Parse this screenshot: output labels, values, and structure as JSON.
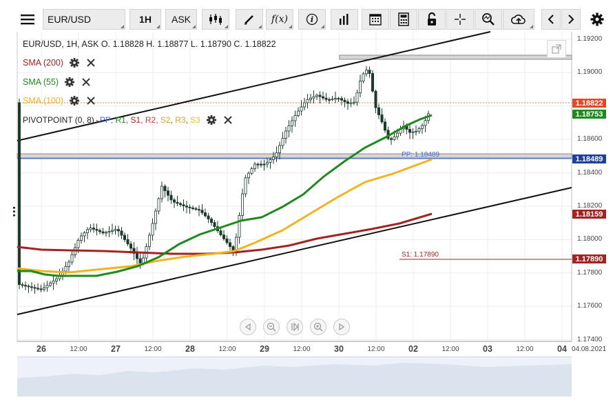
{
  "toolbar": {
    "symbol": "EUR/USD",
    "timeframe": "1H",
    "price_type": "ASK",
    "function_label": "f(x)"
  },
  "header": {
    "info": "EUR/USD, 1H, ASK   O. 1.18828 H. 1.18877 L. 1.18790 C. 1.18822"
  },
  "indicators": {
    "sma200": "SMA (200)",
    "sma55": "SMA (55)",
    "sma100": "SMA (100)",
    "pivot_prefix": "PIVOTPOINT (0, 8)",
    "pivot_pp": "PP",
    "pivot_r1": "R1",
    "pivot_s1": "S1",
    "pivot_r2": "R2",
    "pivot_s2": "S2",
    "pivot_r3": "R3",
    "pivot_s3": "S3"
  },
  "levels": {
    "pp_label": "PP: 1.18489",
    "s1_label": "S1: 1.17890"
  },
  "price_tags": {
    "last": "1.18822",
    "sma55": "1.18753",
    "pp": "1.18489",
    "sma200": "1.18159",
    "s1": "1.17890"
  },
  "y_axis": [
    "1.19200",
    "1.19000",
    "1.18800",
    "1.18600",
    "1.18400",
    "1.18200",
    "1.18000",
    "1.17800",
    "1.17600",
    "1.17400"
  ],
  "x_axis": [
    {
      "label": "26",
      "big": true
    },
    {
      "label": "12:00",
      "big": false
    },
    {
      "label": "27",
      "big": true
    },
    {
      "label": "12:00",
      "big": false
    },
    {
      "label": "28",
      "big": true
    },
    {
      "label": "12:00",
      "big": false
    },
    {
      "label": "29",
      "big": true
    },
    {
      "label": "12:00",
      "big": false
    },
    {
      "label": "30",
      "big": true
    },
    {
      "label": "12:00",
      "big": false
    },
    {
      "label": "02",
      "big": true
    },
    {
      "label": "12:00",
      "big": false
    },
    {
      "label": "03",
      "big": true
    },
    {
      "label": "12:00",
      "big": false
    },
    {
      "label": "04",
      "big": true
    },
    {
      "label": "04.08.2021",
      "big": false
    }
  ],
  "colors": {
    "sma200": "#a32323",
    "sma55": "#1e8a1e",
    "sma100": "#f2b41c",
    "pp": "#3b6fd6",
    "s1": "#a32323",
    "r2": "#d23c3c",
    "last": "#e04a2a"
  },
  "icons": [
    "menu-icon",
    "candles-icon",
    "pen-icon",
    "info-icon",
    "volume-icon",
    "calendar-icon",
    "calculator-icon",
    "lock-icon",
    "crosshair-icon",
    "zoom-icon",
    "cloud-upload-icon",
    "arrow-left-icon",
    "arrow-right-icon",
    "gear-icon",
    "detach-icon",
    "zoom-out-icon",
    "reset-zoom-icon",
    "zoom-in-icon"
  ]
}
